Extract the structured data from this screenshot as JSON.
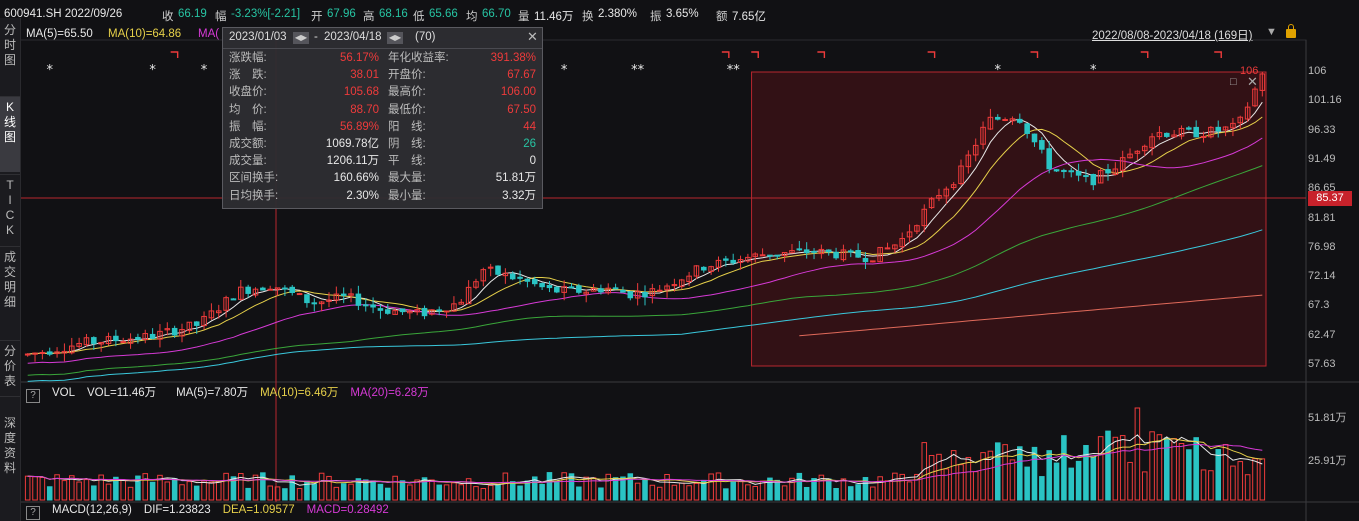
{
  "header": {
    "code_date": "600941.SH 2022/09/26",
    "close_label": "收",
    "close": "66.19",
    "change_label": "幅",
    "change": "-3.23%[-2.21]",
    "open_label": "开",
    "open": "67.96",
    "high_label": "高",
    "high": "68.16",
    "low_label": "低",
    "low": "65.66",
    "avg_label": "均",
    "avg": "66.70",
    "vol_label": "量",
    "vol": "11.46万",
    "turnover_label": "换",
    "turnover": "2.380%",
    "amp_label": "振",
    "amp": "3.65%",
    "amount_label": "额",
    "amount": "7.65亿"
  },
  "sidebar": {
    "items": [
      "分时图",
      "K线图",
      "TICK",
      "成交明细",
      "分价表",
      "深度资料"
    ],
    "active_index": 1
  },
  "ma_legend": [
    "MA(5)=65.50",
    "MA(10)=64.86",
    "MA("
  ],
  "date_range": "2022/08/08-2023/04/18 (169日)",
  "popup": {
    "start": "2023/01/03",
    "end": "2023/04/18",
    "count": "(70)",
    "sep": "-",
    "left_rows": [
      {
        "label": "涨跌幅:",
        "value": "56.17%",
        "color": "red"
      },
      {
        "label": "涨　跌:",
        "value": "38.01",
        "color": "red"
      },
      {
        "label": "收盘价:",
        "value": "105.68",
        "color": "red"
      },
      {
        "label": "均　价:",
        "value": "88.70",
        "color": "red"
      },
      {
        "label": "振　幅:",
        "value": "56.89%",
        "color": "red"
      },
      {
        "label": "成交额:",
        "value": "1069.78亿",
        "color": "white"
      },
      {
        "label": "成交量:",
        "value": "1206.11万",
        "color": "white"
      },
      {
        "label": "区间换手:",
        "value": "160.66%",
        "color": "white"
      },
      {
        "label": "日均换手:",
        "value": "2.30%",
        "color": "white"
      }
    ],
    "right_rows": [
      {
        "label": "年化收益率:",
        "value": "391.38%",
        "color": "red"
      },
      {
        "label": "开盘价:",
        "value": "67.67",
        "color": "red"
      },
      {
        "label": "最高价:",
        "value": "106.00",
        "color": "red"
      },
      {
        "label": "最低价:",
        "value": "67.50",
        "color": "red"
      },
      {
        "label": "阳　线:",
        "value": "44",
        "color": "red"
      },
      {
        "label": "阴　线:",
        "value": "26",
        "color": "green"
      },
      {
        "label": "平　线:",
        "value": "0",
        "color": "white"
      },
      {
        "label": "最大量:",
        "value": "51.81万",
        "color": "white"
      },
      {
        "label": "最小量:",
        "value": "3.32万",
        "color": "white"
      }
    ]
  },
  "price_axis": [
    "106",
    "101.16",
    "96.33",
    "91.49",
    "86.65",
    "81.81",
    "76.98",
    "72.14",
    "67.3",
    "62.47",
    "57.63"
  ],
  "price_crosshair": "85.37",
  "max_marker": "106",
  "volume_legend": {
    "q": "?",
    "name": "VOL",
    "items": [
      {
        "text": "VOL=11.46万",
        "color": "#e8e8e8"
      },
      {
        "text": "MA(5)=7.80万",
        "color": "#e8e8e8"
      },
      {
        "text": "MA(10)=6.46万",
        "color": "#e6d04a"
      },
      {
        "text": "MA(20)=6.28万",
        "color": "#d63ad6"
      }
    ]
  },
  "volume_axis": [
    "51.81万",
    "25.91万"
  ],
  "macd_legend": {
    "q": "?",
    "items": [
      {
        "text": "MACD(12,26,9)",
        "color": "#e8e8e8"
      },
      {
        "text": "DIF=1.23823",
        "color": "#e8e8e8"
      },
      {
        "text": "DEA=1.09577",
        "color": "#e6d04a"
      },
      {
        "text": "MACD=0.28492",
        "color": "#d63ad6"
      }
    ]
  },
  "marker_glyph": "*",
  "colors": {
    "up": "#ee3b3b",
    "down": "#2ac4c4",
    "ma5": "#e8e8e8",
    "ma10": "#e6d04a",
    "ma20": "#d63ad6",
    "ma60": "#3aa63a",
    "ma120": "#3ac8dc",
    "ma250": "#e06a5a"
  },
  "chart_data": {
    "type": "candlestick",
    "x_range": [
      "2022/08/08",
      "2023/04/18"
    ],
    "days": 169,
    "selected_range": [
      "2023/01/03",
      "2023/04/18"
    ],
    "ylim": [
      57.63,
      106
    ],
    "volume_max": "51.81万",
    "waypoints": [
      [
        0,
        59.5
      ],
      [
        12,
        61.5
      ],
      [
        25,
        62.5
      ],
      [
        35,
        64.5
      ],
      [
        43,
        70
      ],
      [
        50,
        71
      ],
      [
        58,
        68
      ],
      [
        65,
        69
      ],
      [
        72,
        67
      ],
      [
        80,
        66.2
      ],
      [
        88,
        68
      ],
      [
        93,
        73.5
      ],
      [
        100,
        72
      ],
      [
        107,
        70
      ],
      [
        114,
        70
      ],
      [
        118,
        70.5
      ],
      [
        123,
        69.5
      ],
      [
        128,
        70
      ],
      [
        138,
        74
      ],
      [
        150,
        76
      ],
      [
        160,
        76.5
      ],
      [
        172,
        75.5
      ],
      [
        178,
        78
      ],
      [
        186,
        86
      ],
      [
        190,
        89
      ],
      [
        196,
        98
      ],
      [
        202,
        99
      ],
      [
        209,
        90
      ],
      [
        217,
        88
      ],
      [
        223,
        91
      ],
      [
        230,
        96
      ],
      [
        240,
        96
      ],
      [
        247,
        97
      ],
      [
        252,
        105.68
      ]
    ]
  }
}
